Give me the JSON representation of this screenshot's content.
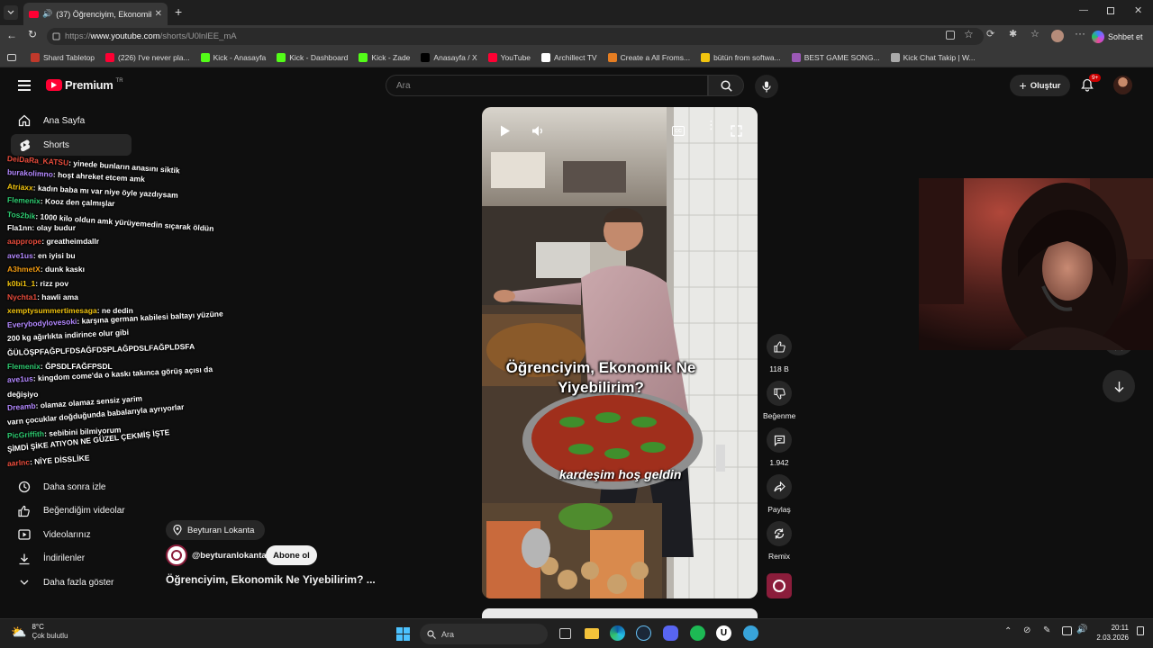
{
  "browser": {
    "tab_title": "(37) Öğrenciyim, Ekonomik Ne",
    "new_tab": "+",
    "url_prefix": "https://",
    "url_host": "www.youtube.com",
    "url_path": "/shorts/U0lnlEE_mA",
    "copilot_label": "Sohbet et",
    "bookmarks": [
      {
        "label": "Shard Tabletop",
        "color": "#c0392b"
      },
      {
        "label": "(226) I've never pla...",
        "color": "#ff0033"
      },
      {
        "label": "Kick - Anasayfa",
        "color": "#53fc18"
      },
      {
        "label": "Kick - Dashboard",
        "color": "#53fc18"
      },
      {
        "label": "Kick - Zade",
        "color": "#53fc18"
      },
      {
        "label": "Anasayfa / X",
        "color": "#000000"
      },
      {
        "label": "YouTube",
        "color": "#ff0033"
      },
      {
        "label": "Archillect TV",
        "color": "#ffffff"
      },
      {
        "label": "Create a All Froms...",
        "color": "#e67e22"
      },
      {
        "label": "bütün from softwa...",
        "color": "#f1c40f"
      },
      {
        "label": "BEST GAME SONG...",
        "color": "#9b59b6"
      },
      {
        "label": "Kick Chat Takip | W...",
        "color": "#aaaaaa"
      }
    ]
  },
  "youtube": {
    "logo": "Premium",
    "logo_badge": "TR",
    "search_placeholder": "Ara",
    "create_label": "Oluştur",
    "notification_count": "9+",
    "sidebar": {
      "top": [
        {
          "label": "Ana Sayfa",
          "icon": "home-icon"
        },
        {
          "label": "Shorts",
          "icon": "shorts-icon"
        }
      ],
      "bottom": [
        {
          "label": "Daha sonra izle",
          "icon": "clock-icon"
        },
        {
          "label": "Beğendiğim videolar",
          "icon": "thumb-up-icon"
        },
        {
          "label": "Videolarınız",
          "icon": "play-icon"
        },
        {
          "label": "İndirilenler",
          "icon": "download-icon"
        },
        {
          "label": "Daha fazla göster",
          "icon": "chevron-down-icon"
        }
      ]
    },
    "short": {
      "caption_top": "Öğrenciyim, Ekonomik Ne Yiyebilirim?",
      "caption_bottom": "kardeşim hoş geldin",
      "location": "Beyturan Lokanta",
      "channel": "@beyturanlokanta",
      "subscribe_label": "Abone ol",
      "title": "Öğrenciyim, Ekonomik Ne Yiyebilirim? ...",
      "likes": "118 B",
      "dislike_label": "Beğenme",
      "comments": "1.942",
      "share_label": "Paylaş",
      "remix_label": "Remix"
    }
  },
  "chat": [
    {
      "user": "DeiDaRa_KATSU",
      "color": "#e74c3c",
      "msg": "yinede bunların anasını siktik"
    },
    {
      "user": "burakolimno",
      "color": "#b388ff",
      "msg": "hoşt ahreket etcem amk"
    },
    {
      "user": "Atriaxx",
      "color": "#f1c40f",
      "msg": "kadın baba mı var niye öyle yazdıysam"
    },
    {
      "user": "Flemenix",
      "color": "#2ecc71",
      "msg": "Kooz den çalmışlar"
    },
    {
      "user": "Tos2bik",
      "color": "#2ecc71",
      "msg": "1000 kilo oldun amk yürüyemedin sıçarak öldün"
    },
    {
      "user": "Fla1nn",
      "color": "#ffffff",
      "msg": "olay budur"
    },
    {
      "user": "aapprope",
      "color": "#e74c3c",
      "msg": "greatheimdallr"
    },
    {
      "user": "ave1us",
      "color": "#b388ff",
      "msg": "en iyisi bu"
    },
    {
      "user": "A3hmetX",
      "color": "#f39c12",
      "msg": "dunk kaskı"
    },
    {
      "user": "k0bi1_1",
      "color": "#f1c40f",
      "msg": "rizz pov"
    },
    {
      "user": "Nychta1",
      "color": "#e74c3c",
      "msg": "hawli ama"
    },
    {
      "user": "xemptysummertimesaga",
      "color": "#f1c40f",
      "msg": "ne dedin"
    },
    {
      "user": "Everybodylovesoki",
      "color": "#b388ff",
      "msg": "karşına german kabilesi baltayı yüzüne"
    },
    {
      "user": "",
      "color": "#ffffff",
      "msg": "200 kg ağırlıkta indirince olur gibi"
    },
    {
      "user": "",
      "color": "#ffffff",
      "msg": "ĞÜLÖŞPFAĞPLFDSAĞFDSPLAĞPDSLFAĞPLDSFA"
    },
    {
      "user": "Flemenix",
      "color": "#2ecc71",
      "msg": "ĞPSDLFAĞFPSDL"
    },
    {
      "user": "ave1us",
      "color": "#b388ff",
      "msg": "kingdom come'da o kaskı takınca görüş açısı da"
    },
    {
      "user": "",
      "color": "#ffffff",
      "msg": "değişiyo"
    },
    {
      "user": "Dreamb",
      "color": "#b388ff",
      "msg": "olamaz olamaz sensiz yarim"
    },
    {
      "user": "",
      "color": "#ffffff",
      "msg": "varn çocuklar doğduğunda babalarıyla ayrıyorlar"
    },
    {
      "user": "PicGriffith",
      "color": "#2ecc71",
      "msg": "sebibini bilmiyorum"
    },
    {
      "user": "",
      "color": "#ffffff",
      "msg": "ŞİMDİ ŞİKE ATIYON NE GÜZEL ÇEKMİŞ İŞTE"
    },
    {
      "user": "aarlnc",
      "color": "#e74c3c",
      "msg": "NİYE DİSSLİKE"
    }
  ],
  "taskbar": {
    "weather_temp": "8°C",
    "weather_desc": "Çok bulutlu",
    "search_label": "Ara",
    "time": "20:11",
    "date": "2.03.2026"
  }
}
